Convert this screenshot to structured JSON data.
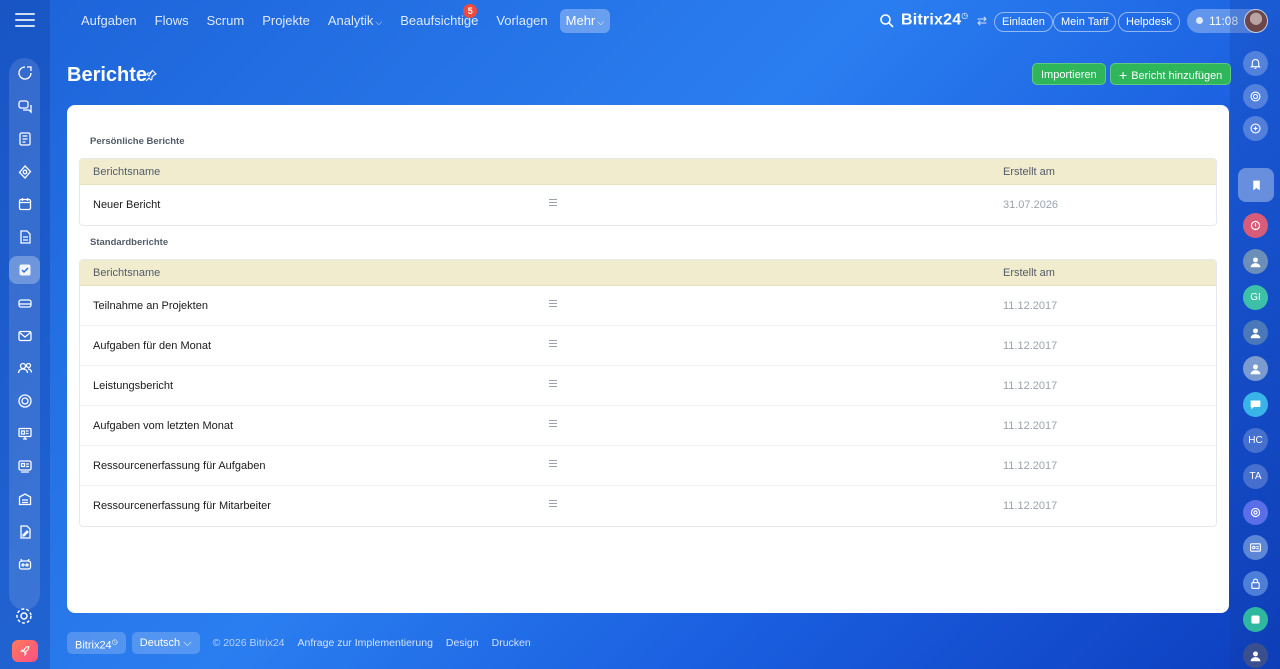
{
  "topnav": {
    "items": [
      {
        "label": "Aufgaben"
      },
      {
        "label": "Flows"
      },
      {
        "label": "Scrum"
      },
      {
        "label": "Projekte"
      },
      {
        "label": "Analytik"
      },
      {
        "label": "Beaufsichtige",
        "badge": "5"
      },
      {
        "label": "Vorlagen"
      },
      {
        "label": "Mehr"
      }
    ]
  },
  "header": {
    "brand": "Bitrix24",
    "invite": "Einladen",
    "plan": "Mein Tarif",
    "helpdesk": "Helpdesk",
    "time": "11:08"
  },
  "page": {
    "title": "Berichte",
    "import_button": "Importieren",
    "add_button": "Bericht hinzufügen"
  },
  "personal": {
    "title": "Persönliche Berichte",
    "col_name": "Berichtsname",
    "col_created": "Erstellt am",
    "rows": [
      {
        "name": "Neuer Bericht",
        "created": "31.07.2026"
      }
    ]
  },
  "standard": {
    "title": "Standardberichte",
    "col_name": "Berichtsname",
    "col_created": "Erstellt am",
    "rows": [
      {
        "name": "Teilnahme an Projekten",
        "created": "11.12.2017"
      },
      {
        "name": "Aufgaben für den Monat",
        "created": "11.12.2017"
      },
      {
        "name": "Leistungsbericht",
        "created": "11.12.2017"
      },
      {
        "name": "Aufgaben vom letzten Monat",
        "created": "11.12.2017"
      },
      {
        "name": "Ressourcenerfassung für Aufgaben",
        "created": "11.12.2017"
      },
      {
        "name": "Ressourcenerfassung für Mitarbeiter",
        "created": "11.12.2017"
      }
    ]
  },
  "right_sidebar": {
    "initials": [
      "GI",
      "HC",
      "TA"
    ]
  },
  "footer": {
    "brand": "Bitrix24",
    "language": "Deutsch",
    "copyright": "© 2026 Bitrix24",
    "links": [
      "Anfrage zur Implementierung",
      "Design",
      "Drucken"
    ]
  },
  "colors": {
    "accent_green": "#2fb55a",
    "table_header": "#f2ecce",
    "badge": "#f0493e"
  }
}
